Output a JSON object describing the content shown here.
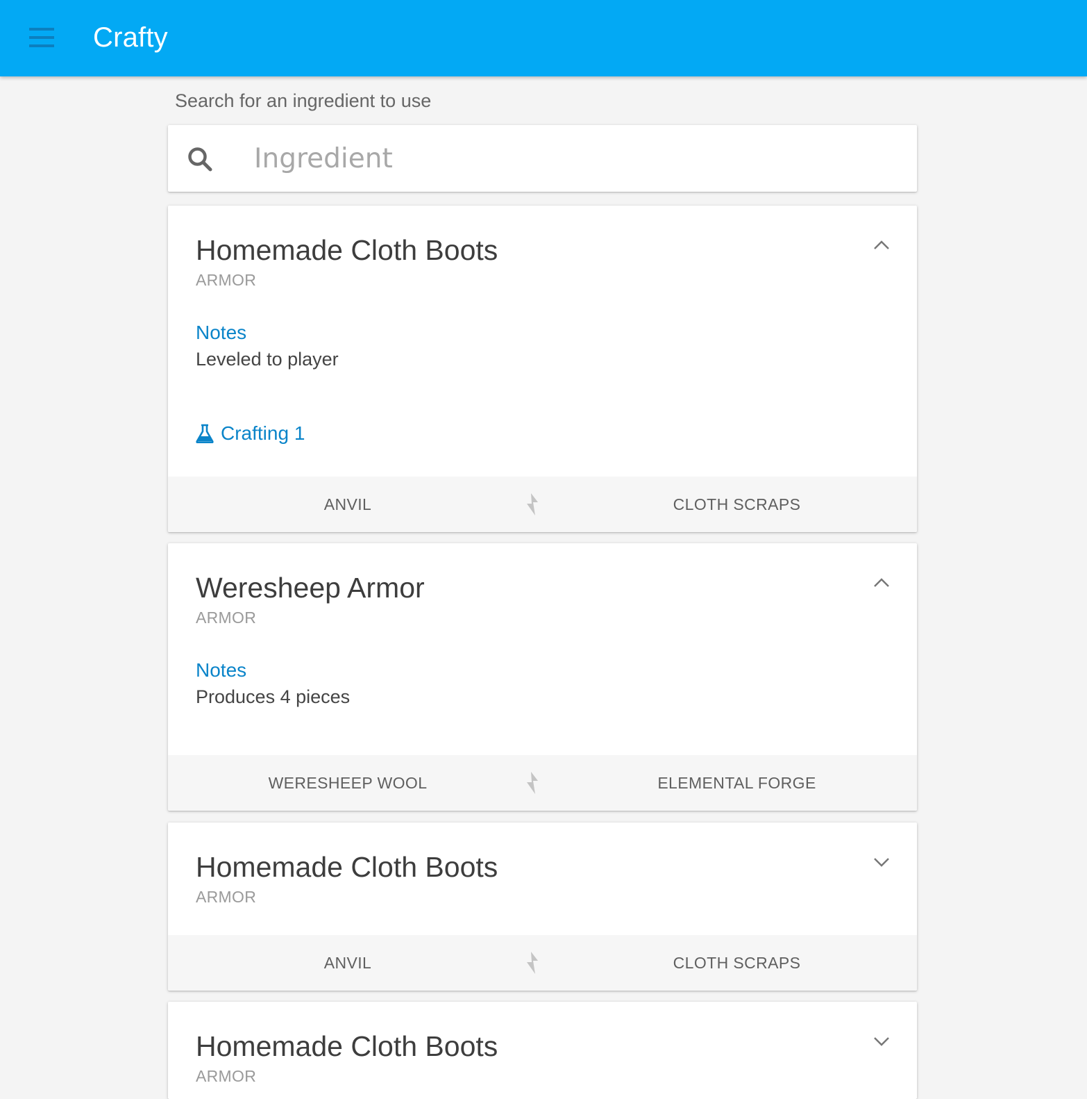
{
  "app": {
    "title": "Crafty",
    "accent_color": "#03a9f4",
    "link_color": "#0a84c9",
    "menu_icon": "hamburger-icon"
  },
  "search": {
    "label": "Search for an ingredient to use",
    "placeholder": "Ingredient",
    "value": "",
    "icon": "search-icon"
  },
  "recipes": [
    {
      "title": "Homemade Cloth Boots",
      "category": "ARMOR",
      "expanded": true,
      "notes_label": "Notes",
      "notes": "Leveled to player",
      "crafting": "Crafting 1",
      "left_ingredient": "ANVIL",
      "right_ingredient": "CLOTH SCRAPS"
    },
    {
      "title": "Weresheep Armor",
      "category": "ARMOR",
      "expanded": true,
      "notes_label": "Notes",
      "notes": "Produces 4 pieces",
      "left_ingredient": "WERESHEEP WOOL",
      "right_ingredient": "ELEMENTAL FORGE"
    },
    {
      "title": "Homemade Cloth Boots",
      "category": "ARMOR",
      "expanded": false,
      "left_ingredient": "ANVIL",
      "right_ingredient": "CLOTH SCRAPS"
    },
    {
      "title": "Homemade Cloth Boots",
      "category": "ARMOR",
      "expanded": false
    }
  ]
}
